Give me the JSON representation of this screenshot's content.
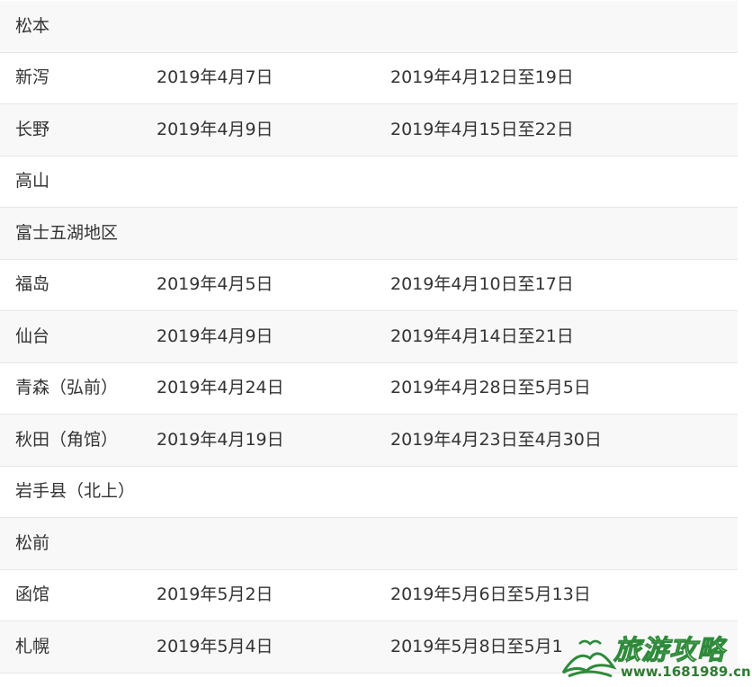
{
  "rows": [
    {
      "city": "松本",
      "start": "",
      "peak": ""
    },
    {
      "city": "新泻",
      "start": "2019年4月7日",
      "peak": "2019年4月12日至19日"
    },
    {
      "city": "长野",
      "start": "2019年4月9日",
      "peak": "2019年4月15日至22日"
    },
    {
      "city": "高山",
      "start": "",
      "peak": ""
    },
    {
      "city": "富士五湖地区",
      "start": "",
      "peak": ""
    },
    {
      "city": "福岛",
      "start": "2019年4月5日",
      "peak": "2019年4月10日至17日"
    },
    {
      "city": "仙台",
      "start": "2019年4月9日",
      "peak": "2019年4月14日至21日"
    },
    {
      "city": "青森（弘前）",
      "start": "2019年4月24日",
      "peak": "2019年4月28日至5月5日"
    },
    {
      "city": "秋田（角馆）",
      "start": "2019年4月19日",
      "peak": "2019年4月23日至4月30日"
    },
    {
      "city": "岩手县（北上）",
      "start": "",
      "peak": ""
    },
    {
      "city": "松前",
      "start": "",
      "peak": ""
    },
    {
      "city": "函馆",
      "start": "2019年5月2日",
      "peak": "2019年5月6日至5月13日"
    },
    {
      "city": "札幌",
      "start": "2019年5月4日",
      "peak": "2019年5月8日至5月1"
    }
  ],
  "watermark": {
    "title": "旅游攻略",
    "url": "www.1681989.cn",
    "icon": "mountain-bird-logo-icon",
    "colors": {
      "green": "#2e8a3a",
      "dark_green": "#2e7d32"
    }
  },
  "colors": {
    "row_alt": "#f8f8f8",
    "row": "#ffffff",
    "border": "#e6e6e6",
    "text": "#333333"
  }
}
